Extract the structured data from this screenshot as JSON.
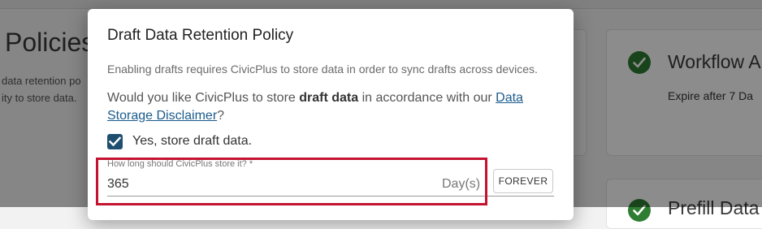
{
  "background": {
    "page_title": "Policies",
    "description_lines": [
      "data retention po",
      "ity to store data."
    ],
    "cards": [
      {
        "title": "Workflow A",
        "subtitle": "Expire after 7 Da"
      },
      {
        "title": "Prefill Data"
      }
    ]
  },
  "dialog": {
    "title": "Draft Data Retention Policy",
    "note": "Enabling drafts requires CivicPlus to store data in order to sync drafts across devices.",
    "question": {
      "before": "Would you like CivicPlus to store ",
      "bold": "draft data",
      "middle": " in accordance with our ",
      "link": "Data Storage Disclaimer",
      "after": "?"
    },
    "checkbox": {
      "label": "Yes, store draft data.",
      "checked": true
    },
    "retention_field": {
      "label": "How long should CivicPlus store it? *",
      "value": "365",
      "suffix": "Day(s)"
    },
    "forever_button": "FOREVER"
  },
  "colors": {
    "accent": "#1f4f70",
    "link": "#1a5b8c",
    "success": "#2e7d32",
    "highlight": "#c4122f"
  }
}
